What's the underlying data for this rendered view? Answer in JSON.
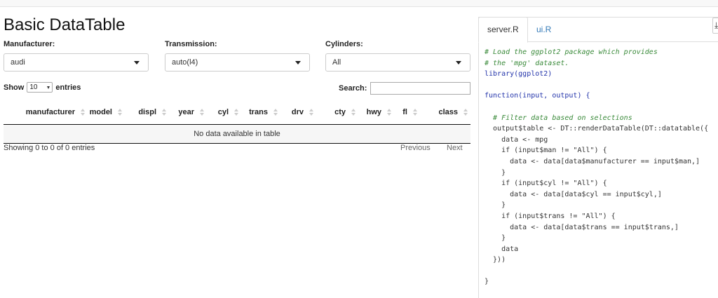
{
  "app": {
    "title": "Basic DataTable",
    "filters": [
      {
        "label": "Manufacturer:",
        "value": "audi"
      },
      {
        "label": "Transmission:",
        "value": "auto(l4)"
      },
      {
        "label": "Cylinders:",
        "value": "All"
      }
    ],
    "table": {
      "show_label": "Show",
      "entries_value": "10",
      "entries_label": "entries",
      "search_label": "Search:",
      "columns": [
        "manufacturer",
        "model",
        "displ",
        "year",
        "cyl",
        "trans",
        "drv",
        "cty",
        "hwy",
        "fl",
        "class"
      ],
      "empty_message": "No data available in table",
      "info": "Showing 0 to 0 of 0 entries",
      "previous": "Previous",
      "next": "Next"
    }
  },
  "code_pane": {
    "tabs": [
      "server.R",
      "ui.R"
    ],
    "corner_icon": "download-icon",
    "lines": [
      "# Load the ggplot2 package which provides",
      "# the 'mpg' dataset.",
      "library(ggplot2)",
      "",
      "function(input, output) {",
      "",
      "  # Filter data based on selections",
      "  output$table <- DT::renderDataTable(DT::datatable({",
      "    data <- mpg",
      "    if (input$man != \"All\") {",
      "      data <- data[data$manufacturer == input$man,]",
      "    }",
      "    if (input$cyl != \"All\") {",
      "      data <- data[data$cyl == input$cyl,]",
      "    }",
      "    if (input$trans != \"All\") {",
      "      data <- data[data$trans == input$trans,]",
      "    }",
      "    data",
      "  }))",
      "",
      "}"
    ]
  }
}
